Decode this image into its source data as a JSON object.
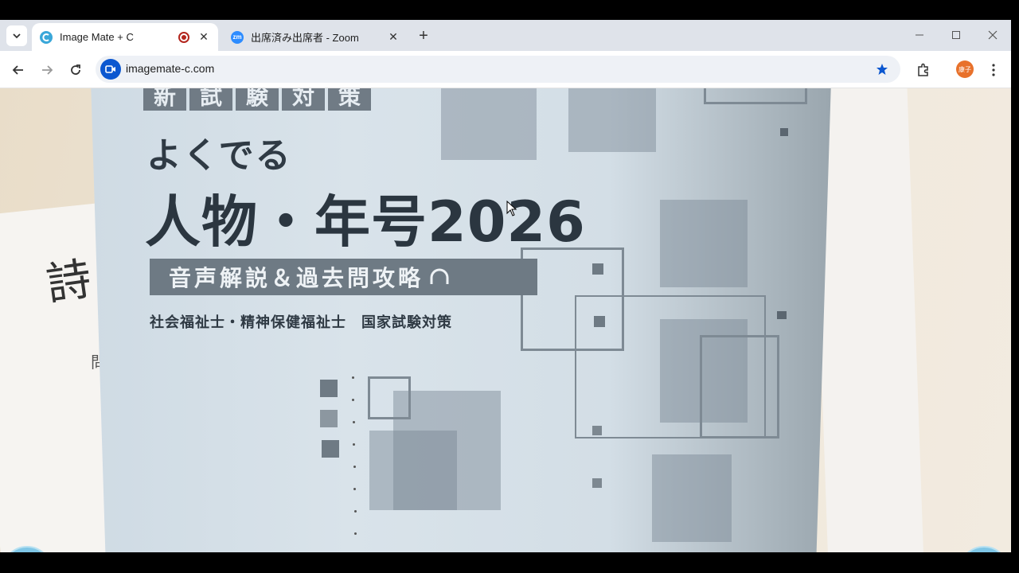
{
  "browser": {
    "tabs": [
      {
        "title": "Image Mate + C",
        "active": true,
        "favicon": "imagemate-icon",
        "recording": true
      },
      {
        "title": "出席済み出席者 - Zoom",
        "active": false,
        "favicon": "zoom-icon",
        "favicon_text": "zm"
      }
    ],
    "url": "imagemate-c.com",
    "profile_label": "康子",
    "accent": "#0b57d0"
  },
  "cover": {
    "tag_chars": [
      "新",
      "試",
      "験",
      "対",
      "策"
    ],
    "subtitle": "よくでる",
    "title": "人物・年号2026",
    "band_text": "音声解説＆過去問攻略",
    "footer": "社会福祉士・精神保健福祉士　国家試験対策"
  },
  "left_paper": {
    "handwritten": "詩",
    "small_text": "問"
  }
}
